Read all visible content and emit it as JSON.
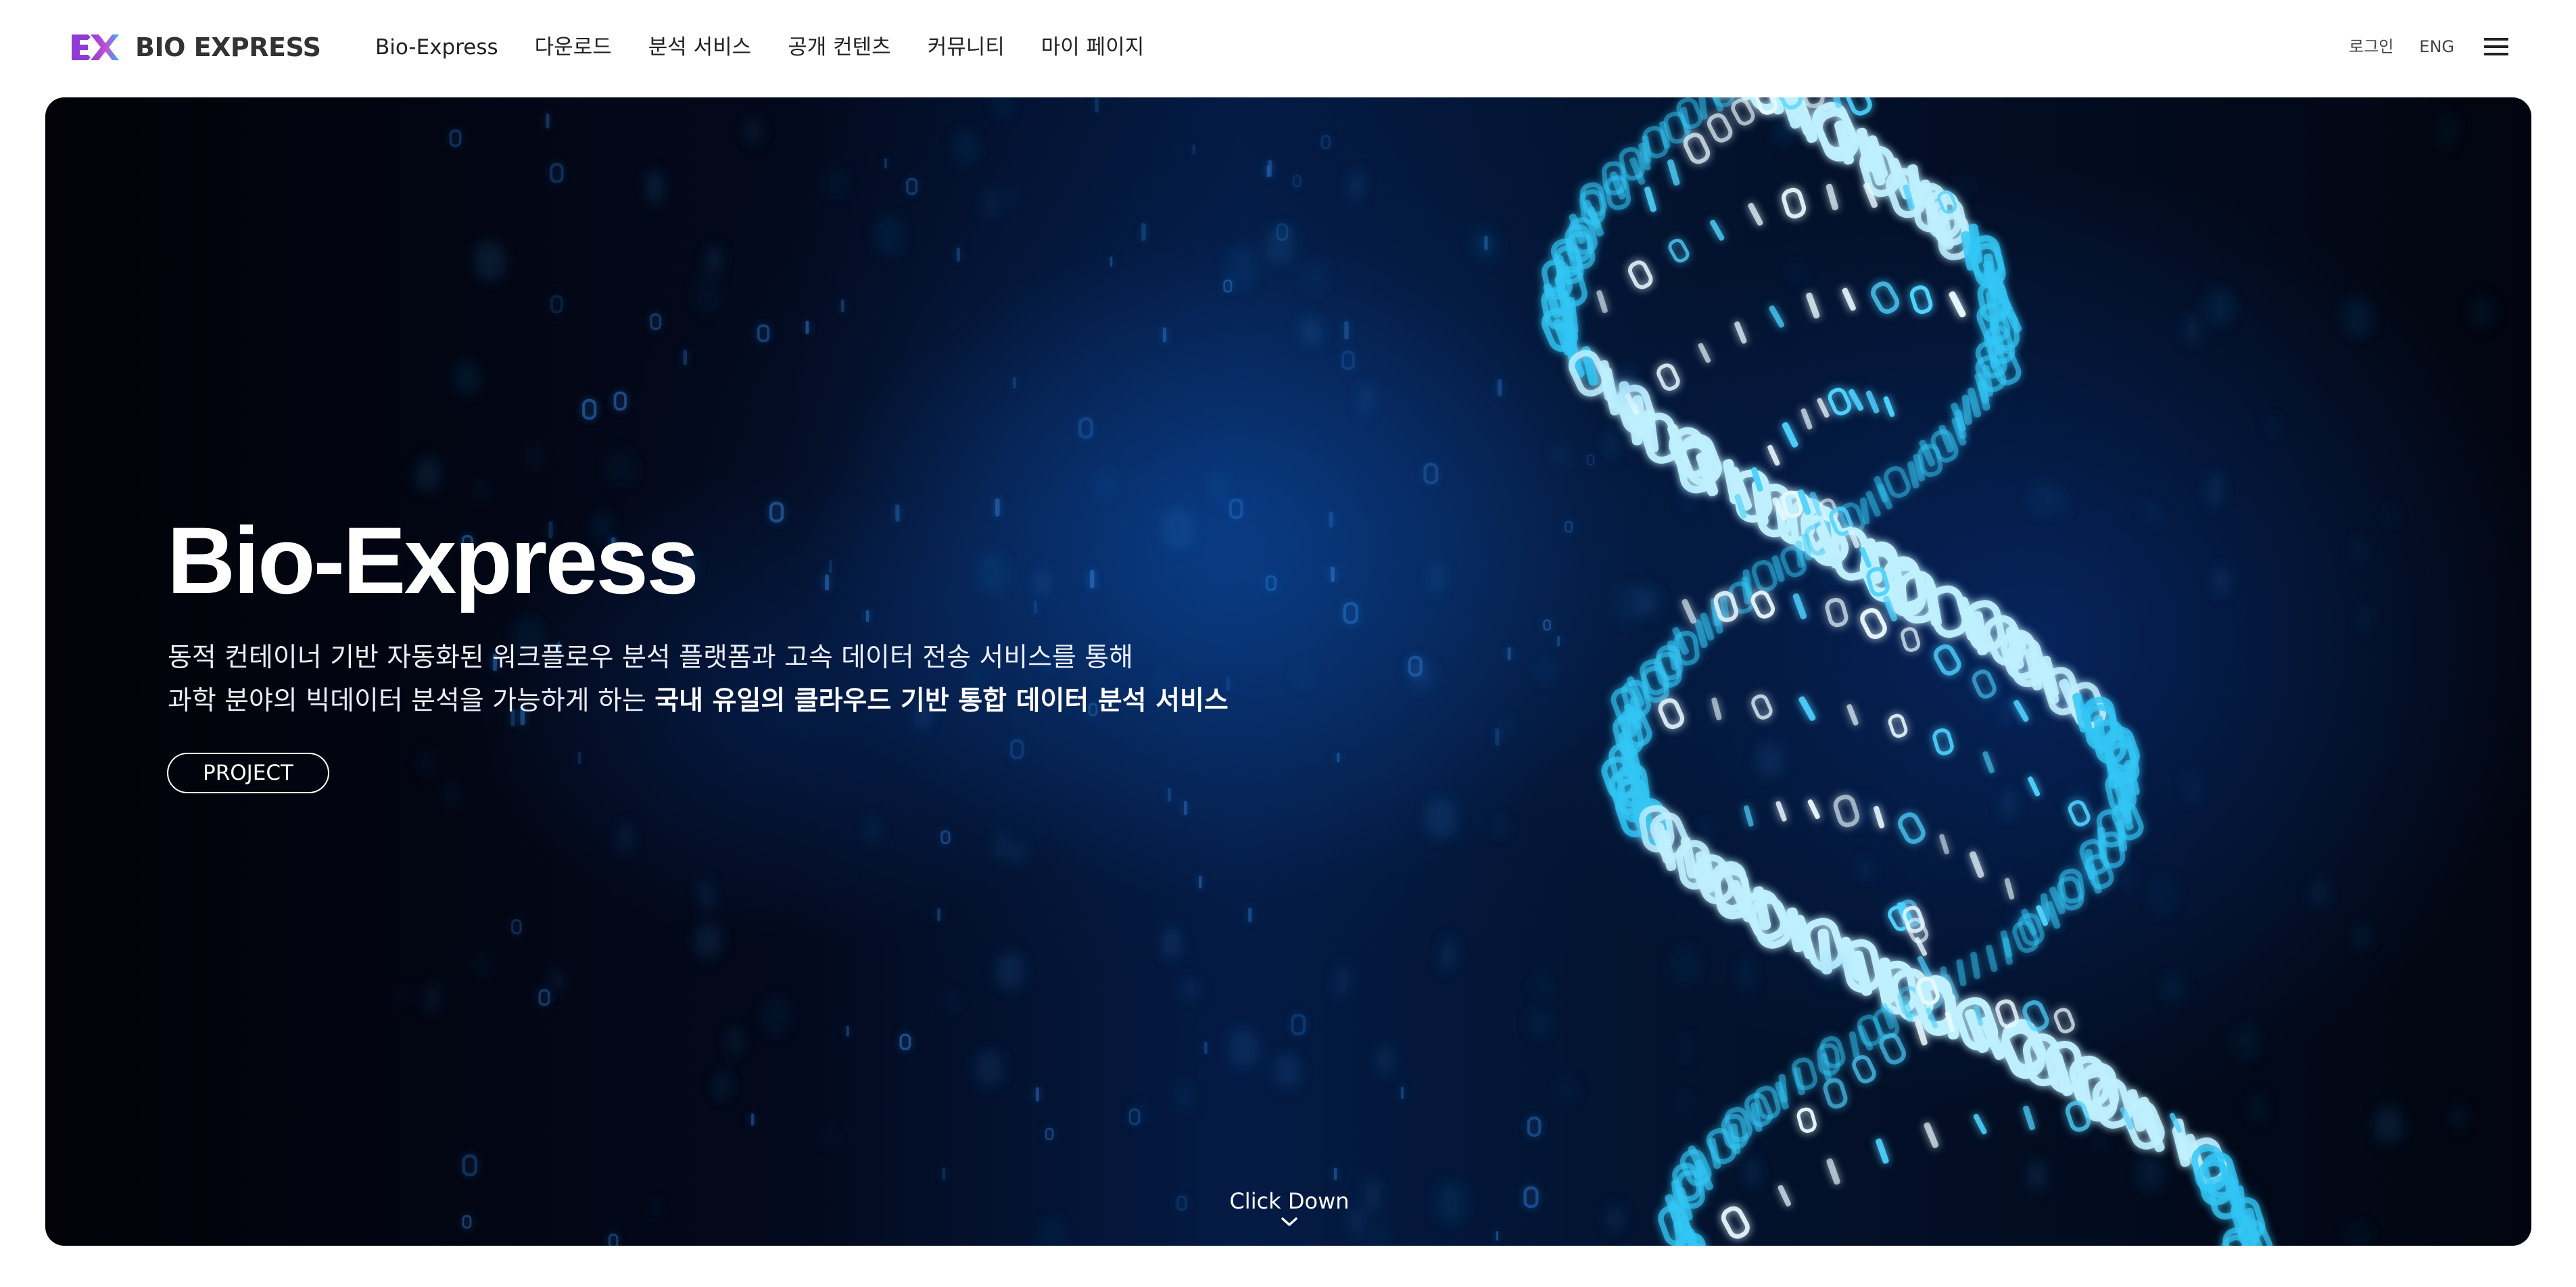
{
  "brand": {
    "name": "BIO EXPRESS",
    "colors": {
      "mark_purple": "#8f3bd6",
      "mark_magenta": "#c24fd8",
      "mark_cyan": "#2bb8e8",
      "text": "#333333"
    }
  },
  "nav": {
    "items": [
      {
        "label": "Bio-Express"
      },
      {
        "label": "다운로드"
      },
      {
        "label": "분석 서비스"
      },
      {
        "label": "공개 컨텐츠"
      },
      {
        "label": "커뮤니티"
      },
      {
        "label": "마이 페이지"
      }
    ]
  },
  "util": {
    "login_label": "로그인",
    "lang_label": "ENG",
    "menu_icon": "hamburger-menu-icon"
  },
  "hero": {
    "title": "Bio-Express",
    "desc_line1": "동적 컨테이너 기반 자동화된 워크플로우 분석 플랫폼과 고속 데이터 전송 서비스를 통해",
    "desc_line2_regular": "과학 분야의 빅데이터 분석을 가능하게 하는 ",
    "desc_line2_bold": "국내 유일의 클라우드 기반 통합 데이터 분석 서비스",
    "button_label": "PROJECT",
    "scroll_label": "Click Down",
    "scroll_icon": "chevron-down-icon",
    "colors": {
      "background": "#03091c",
      "accent_glow": "#0b3e8a",
      "binary_cyan": "#39d0ff",
      "text": "#ffffff"
    }
  }
}
